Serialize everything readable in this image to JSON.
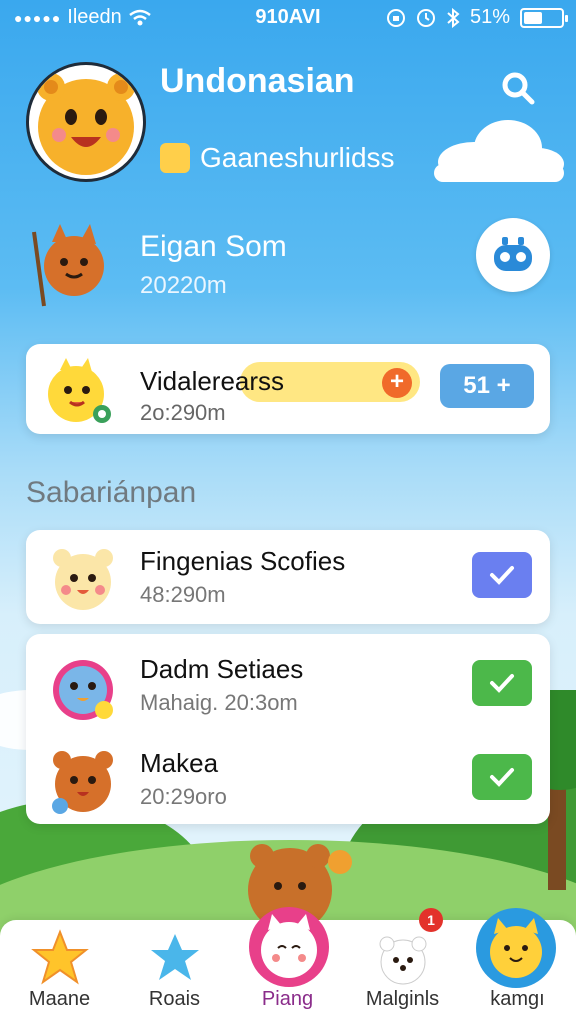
{
  "status_bar": {
    "carrier": "Ileedn",
    "time": "910AVI",
    "battery": "51%",
    "battery_level": 0.51
  },
  "header": {
    "title": "Undonasian",
    "subtitle": "Gaaneshurlidss"
  },
  "featured": {
    "name": "Eigan Som",
    "subtitle": "20220m"
  },
  "highlight_card": {
    "name": "Vidalerearss",
    "subtitle": "2o:290m",
    "count_label": "51 +"
  },
  "section": {
    "label": "Sabariánpan"
  },
  "list_items": [
    {
      "name": "Fingenias Scofies",
      "subtitle": "48:290m",
      "checked": true,
      "color": "#6a7ff0"
    },
    {
      "name": "Dadm Setiaes",
      "subtitle": "Mahaig. 20:3om",
      "checked": true,
      "color": "#4cb84a"
    },
    {
      "name": "Makea",
      "subtitle": "20:29oro",
      "checked": true,
      "color": "#4cb84a"
    }
  ],
  "nav": {
    "items": [
      {
        "label": "Maane",
        "icon": "star-icon"
      },
      {
        "label": "Roais",
        "icon": "blue-star-icon"
      },
      {
        "label": "Piang",
        "icon": "cat-icon",
        "active": true
      },
      {
        "label": "Malginls",
        "icon": "bear-icon",
        "badge": "1"
      },
      {
        "label": "kamgı",
        "icon": "yellow-cat-icon"
      }
    ]
  },
  "colors": {
    "sky_top": "#3aa8ee",
    "accent_blue": "#5aa7e4",
    "check_blue": "#6a7ff0",
    "check_green": "#4cb84a",
    "badge_red": "#e3322b"
  }
}
